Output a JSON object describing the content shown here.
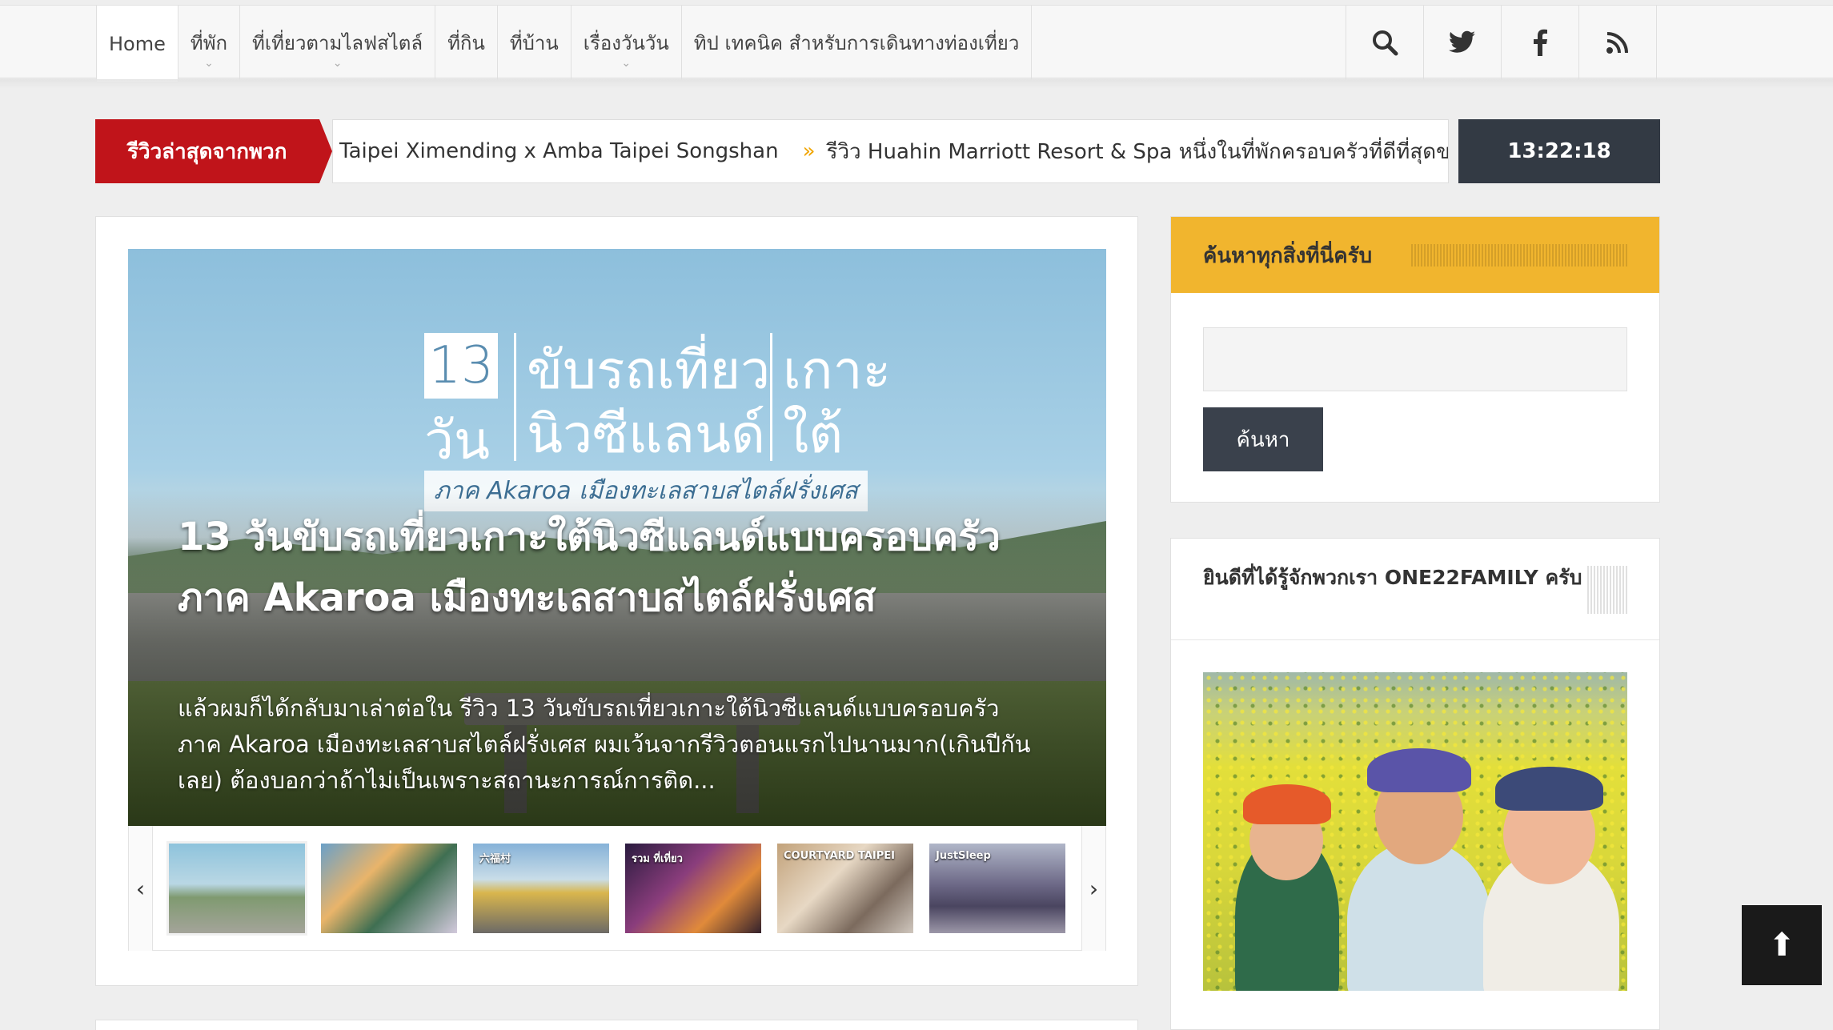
{
  "nav": {
    "items": [
      {
        "label": "Home",
        "has_dropdown": false
      },
      {
        "label": "ที่พัก",
        "has_dropdown": true
      },
      {
        "label": "ที่เที่ยวตามไลฟสไตล์",
        "has_dropdown": true
      },
      {
        "label": "ที่กิน",
        "has_dropdown": false
      },
      {
        "label": "ที่บ้าน",
        "has_dropdown": false
      },
      {
        "label": "เรื่องวันวัน",
        "has_dropdown": true
      },
      {
        "label": "ทิป เทคนิค สำหรับการเดินทางท่องเที่ยว",
        "has_dropdown": false
      }
    ],
    "chevron": "⌄",
    "social_icons": [
      "search-icon",
      "twitter-icon",
      "facebook-icon",
      "rss-icon"
    ]
  },
  "ticker": {
    "label": "รีวิวล่าสุดจากพวก",
    "item1": "Taipei Ximending x Amba Taipei Songshan",
    "separator": "»",
    "item2": "รีวิว Huahin Marriott Resort & Spa หนึ่งในที่พักครอบครัวที่ดีที่สุดของหัวหิน",
    "clock": "13:22:18"
  },
  "hero": {
    "poster_number": "13",
    "poster_day": "วัน",
    "poster_line1": "ขับรถเที่ยว",
    "poster_line2": "นิวซีแลนด์",
    "poster_line3": "เกาะ",
    "poster_line4": "ใต้",
    "poster_sub": "ภาค Akaroa เมืองทะเลสาบสไตล์ฝรั่งเศส",
    "title": "13 วันขับรถเที่ยวเกาะใต้นิวซีแลนด์แบบครอบครัวภาค Akaroa เมืองทะเลสาบสไตล์ฝรั่งเศส",
    "excerpt": "แล้วผมก็ได้กลับมาเล่าต่อใน  รีวิว 13 วันขับรถเที่ยวเกาะใต้นิวซีแลนด์แบบครอบครัวภาค Akaroa เมืองทะเลสาบสไตล์ฝรั่งเศส ผมเว้นจากรีวิวตอนแรกไปนานมาก(เกินปีกันเลย) ต้องบอกว่าถ้าไม่เป็นเพราะสถานะการณ์การติด..."
  },
  "thumbs": {
    "prev": "‹",
    "next": "›",
    "labels": [
      "",
      "",
      "六福村",
      "รวม ที่เที่ยว",
      "COURTYARD TAIPEI",
      "JustSleep"
    ]
  },
  "search_widget": {
    "title": "ค้นหาทุกสิ่งที่นี่ครับ",
    "input_value": "",
    "button": "ค้นหา"
  },
  "about_widget": {
    "title": "ยินดีที่ได้รู้จักพวกเรา ONE22FAMILY ครับ"
  },
  "scroll_top": "⬆",
  "colors": {
    "ticker_red": "#c0141a",
    "widget_yellow": "#f1b52e",
    "dark_button": "#3a414c",
    "clock_bg": "#333a44"
  }
}
